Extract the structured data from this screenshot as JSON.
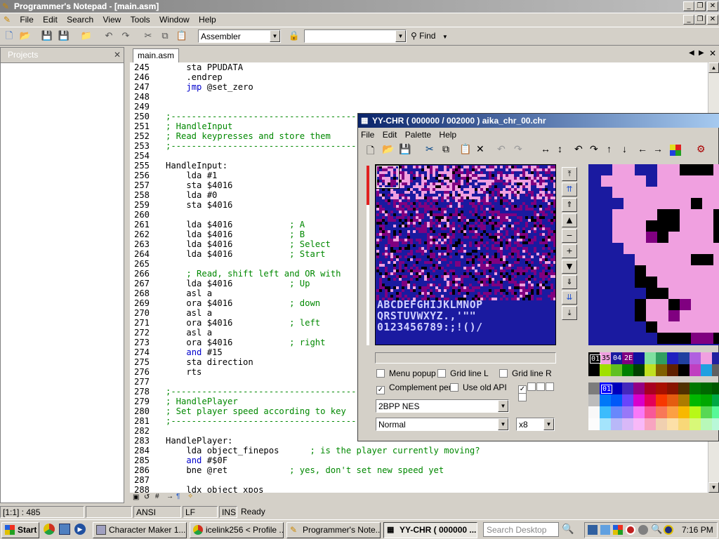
{
  "window": {
    "title": "Programmer's Notepad - [main.asm]"
  },
  "menu": [
    "File",
    "Edit",
    "Search",
    "View",
    "Tools",
    "Window",
    "Help"
  ],
  "toolbar": {
    "scheme": "Assembler",
    "find_label": "Find",
    "search_value": ""
  },
  "projects": {
    "title": "Projects"
  },
  "tabs": [
    {
      "label": "main.asm"
    }
  ],
  "code": [
    {
      "n": "245",
      "t": "    sta PPUDATA"
    },
    {
      "n": "246",
      "t": "    .endrep"
    },
    {
      "n": "247",
      "t": "    jmp @set_zero"
    },
    {
      "n": "248",
      "t": ""
    },
    {
      "n": "249",
      "t": ""
    },
    {
      "n": "250",
      "t": ";----------------------------------------------------"
    },
    {
      "n": "251",
      "t": "; HandleInput"
    },
    {
      "n": "252",
      "t": "; Read keypresses and store them"
    },
    {
      "n": "253",
      "t": ";----------------------------------------------------"
    },
    {
      "n": "254",
      "t": ""
    },
    {
      "n": "255",
      "t": "HandleInput:"
    },
    {
      "n": "256",
      "t": "    lda #1"
    },
    {
      "n": "257",
      "t": "    sta $4016"
    },
    {
      "n": "258",
      "t": "    lda #0"
    },
    {
      "n": "259",
      "t": "    sta $4016"
    },
    {
      "n": "260",
      "t": ""
    },
    {
      "n": "261",
      "t": "    lda $4016           ; A"
    },
    {
      "n": "262",
      "t": "    lda $4016           ; B"
    },
    {
      "n": "263",
      "t": "    lda $4016           ; Select"
    },
    {
      "n": "264",
      "t": "    lda $4016           ; Start"
    },
    {
      "n": "265",
      "t": ""
    },
    {
      "n": "266",
      "t": "    ; Read, shift left and OR with"
    },
    {
      "n": "267",
      "t": "    lda $4016           ; Up"
    },
    {
      "n": "268",
      "t": "    asl a"
    },
    {
      "n": "269",
      "t": "    ora $4016           ; down"
    },
    {
      "n": "270",
      "t": "    asl a"
    },
    {
      "n": "271",
      "t": "    ora $4016           ; left"
    },
    {
      "n": "272",
      "t": "    asl a"
    },
    {
      "n": "273",
      "t": "    ora $4016           ; right"
    },
    {
      "n": "274",
      "t": "    and #15"
    },
    {
      "n": "275",
      "t": "    sta direction"
    },
    {
      "n": "276",
      "t": "    rts"
    },
    {
      "n": "277",
      "t": ""
    },
    {
      "n": "278",
      "t": ";----------------------------------------------------"
    },
    {
      "n": "279",
      "t": "; HandlePlayer"
    },
    {
      "n": "280",
      "t": "; Set player speed according to key"
    },
    {
      "n": "281",
      "t": ";----------------------------------------------------"
    },
    {
      "n": "282",
      "t": ""
    },
    {
      "n": "283",
      "t": "HandlePlayer:"
    },
    {
      "n": "284",
      "t": "    lda object_finepos      ; is the player currently moving?"
    },
    {
      "n": "285",
      "t": "    and #$0F"
    },
    {
      "n": "286",
      "t": "    bne @ret            ; yes, don't set new speed yet"
    },
    {
      "n": "287",
      "t": ""
    },
    {
      "n": "288",
      "t": "    ldx object_xpos"
    }
  ],
  "status": {
    "pos": "[1:1] : 485",
    "enc": "ANSI",
    "eol": "LF",
    "mode": "INS",
    "state": "Ready"
  },
  "yychr": {
    "title": "YY-CHR ( 000000 / 002000 )  aika_chr_00.chr",
    "menu": [
      "File",
      "Edit",
      "Palette",
      "Help"
    ],
    "options": {
      "menu_popup": "Menu popup",
      "grid_l": "Grid line L",
      "grid_r": "Grid line R",
      "complement": "Complement pen",
      "old_api": "Use old API"
    },
    "format": "2BPP NES",
    "pattern": "Normal",
    "zoom": "x8",
    "palette_labels": [
      "01",
      "35",
      "04",
      "2E"
    ],
    "sel_index": "01",
    "tile_text": [
      "ABCDEFGHIJKLMNOP",
      "QRSTUVWXYZ.,'\"\"",
      "0123456789:;!()/"
    ]
  },
  "taskbar": {
    "start": "Start",
    "buttons": [
      "Character Maker 1...",
      "icelink256 < Profile ...",
      "Programmer's Note...",
      "YY-CHR ( 000000 ..."
    ],
    "search_placeholder": "Search Desktop",
    "clock": "7:16 PM"
  }
}
